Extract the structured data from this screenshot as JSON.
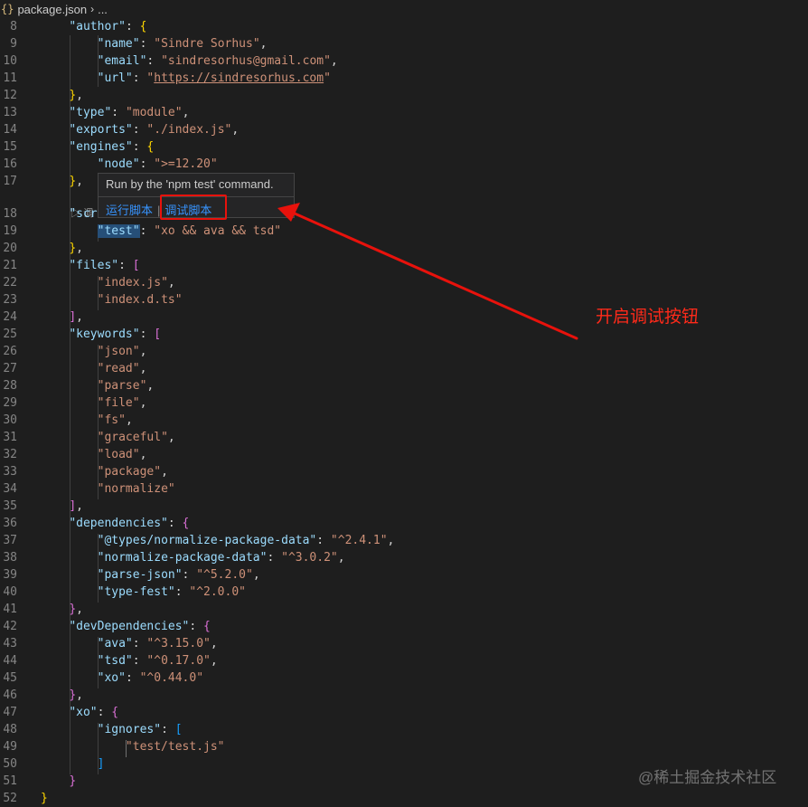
{
  "breadcrumb": {
    "icon_text": "{}",
    "filename": "package.json",
    "trailing": "..."
  },
  "code_lines": [
    {
      "n": "8"
    },
    {
      "n": "9"
    },
    {
      "n": "10"
    },
    {
      "n": "11"
    },
    {
      "n": "12"
    },
    {
      "n": "13"
    },
    {
      "n": "14"
    },
    {
      "n": "15"
    },
    {
      "n": "16"
    },
    {
      "n": "17"
    },
    {
      "n": "18"
    },
    {
      "n": "19"
    },
    {
      "n": "20"
    },
    {
      "n": "21"
    },
    {
      "n": "22"
    },
    {
      "n": "23"
    },
    {
      "n": "24"
    },
    {
      "n": "25"
    },
    {
      "n": "26"
    },
    {
      "n": "27"
    },
    {
      "n": "28"
    },
    {
      "n": "29"
    },
    {
      "n": "30"
    },
    {
      "n": "31"
    },
    {
      "n": "32"
    },
    {
      "n": "33"
    },
    {
      "n": "34"
    },
    {
      "n": "35"
    },
    {
      "n": "36"
    },
    {
      "n": "37"
    },
    {
      "n": "38"
    },
    {
      "n": "39"
    },
    {
      "n": "40"
    },
    {
      "n": "41"
    },
    {
      "n": "42"
    },
    {
      "n": "43"
    },
    {
      "n": "44"
    },
    {
      "n": "45"
    },
    {
      "n": "46"
    },
    {
      "n": "47"
    },
    {
      "n": "48"
    },
    {
      "n": "49"
    },
    {
      "n": "50"
    },
    {
      "n": "51"
    },
    {
      "n": "52"
    }
  ],
  "tokens": {
    "author": "\"author\"",
    "name_k": "\"name\"",
    "name_v": "\"Sindre Sorhus\"",
    "email_k": "\"email\"",
    "email_v": "\"sindresorhus@gmail.com\"",
    "url_k": "\"url\"",
    "url_v": "https://sindresorhus.com",
    "type_k": "\"type\"",
    "type_v": "\"module\"",
    "exports_k": "\"exports\"",
    "exports_v": "\"./index.js\"",
    "engines_k": "\"engines\"",
    "node_k": "\"node\"",
    "node_v": "\">=12.20\"",
    "scripts_k": "\"scr",
    "test_k": "\"test\"",
    "test_v": "\"xo && ava && tsd\"",
    "files_k": "\"files\"",
    "files_1": "\"index.js\"",
    "files_2": "\"index.d.ts\"",
    "keywords_k": "\"keywords\"",
    "kw_1": "\"json\"",
    "kw_2": "\"read\"",
    "kw_3": "\"parse\"",
    "kw_4": "\"file\"",
    "kw_5": "\"fs\"",
    "kw_6": "\"graceful\"",
    "kw_7": "\"load\"",
    "kw_8": "\"package\"",
    "kw_9": "\"normalize\"",
    "deps_k": "\"dependencies\"",
    "dep1_k": "\"@types/normalize-package-data\"",
    "dep1_v": "\"^2.4.1\"",
    "dep2_k": "\"normalize-package-data\"",
    "dep2_v": "\"^3.0.2\"",
    "dep3_k": "\"parse-json\"",
    "dep3_v": "\"^5.2.0\"",
    "dep4_k": "\"type-fest\"",
    "dep4_v": "\"^2.0.0\"",
    "devdeps_k": "\"devDependencies\"",
    "dev1_k": "\"ava\"",
    "dev1_v": "\"^3.15.0\"",
    "dev2_k": "\"tsd\"",
    "dev2_v": "\"^0.17.0\"",
    "dev3_k": "\"xo\"",
    "dev3_v": "\"^0.44.0\"",
    "xo_k": "\"xo\"",
    "ignores_k": "\"ignores\"",
    "ignores_1": "\"test/test.js\""
  },
  "codelens": {
    "icon": "▷",
    "text": "调"
  },
  "hover": {
    "tooltip": "Run by the 'npm test' command.",
    "run_label": "运行脚本",
    "separator": "|",
    "debug_label": "调试脚本"
  },
  "annotation": {
    "text": "开启调试按钮",
    "color": "#ff2a1a"
  },
  "watermark": "@稀土掘金技术社区",
  "theme": {
    "background": "#1e1e1e",
    "key": "#9cdcfe",
    "string": "#ce9178",
    "bracket_level1": "#da70d6",
    "bracket_level2": "#179fff",
    "bracket_level3": "#ffd700",
    "link": "#3794ff"
  }
}
